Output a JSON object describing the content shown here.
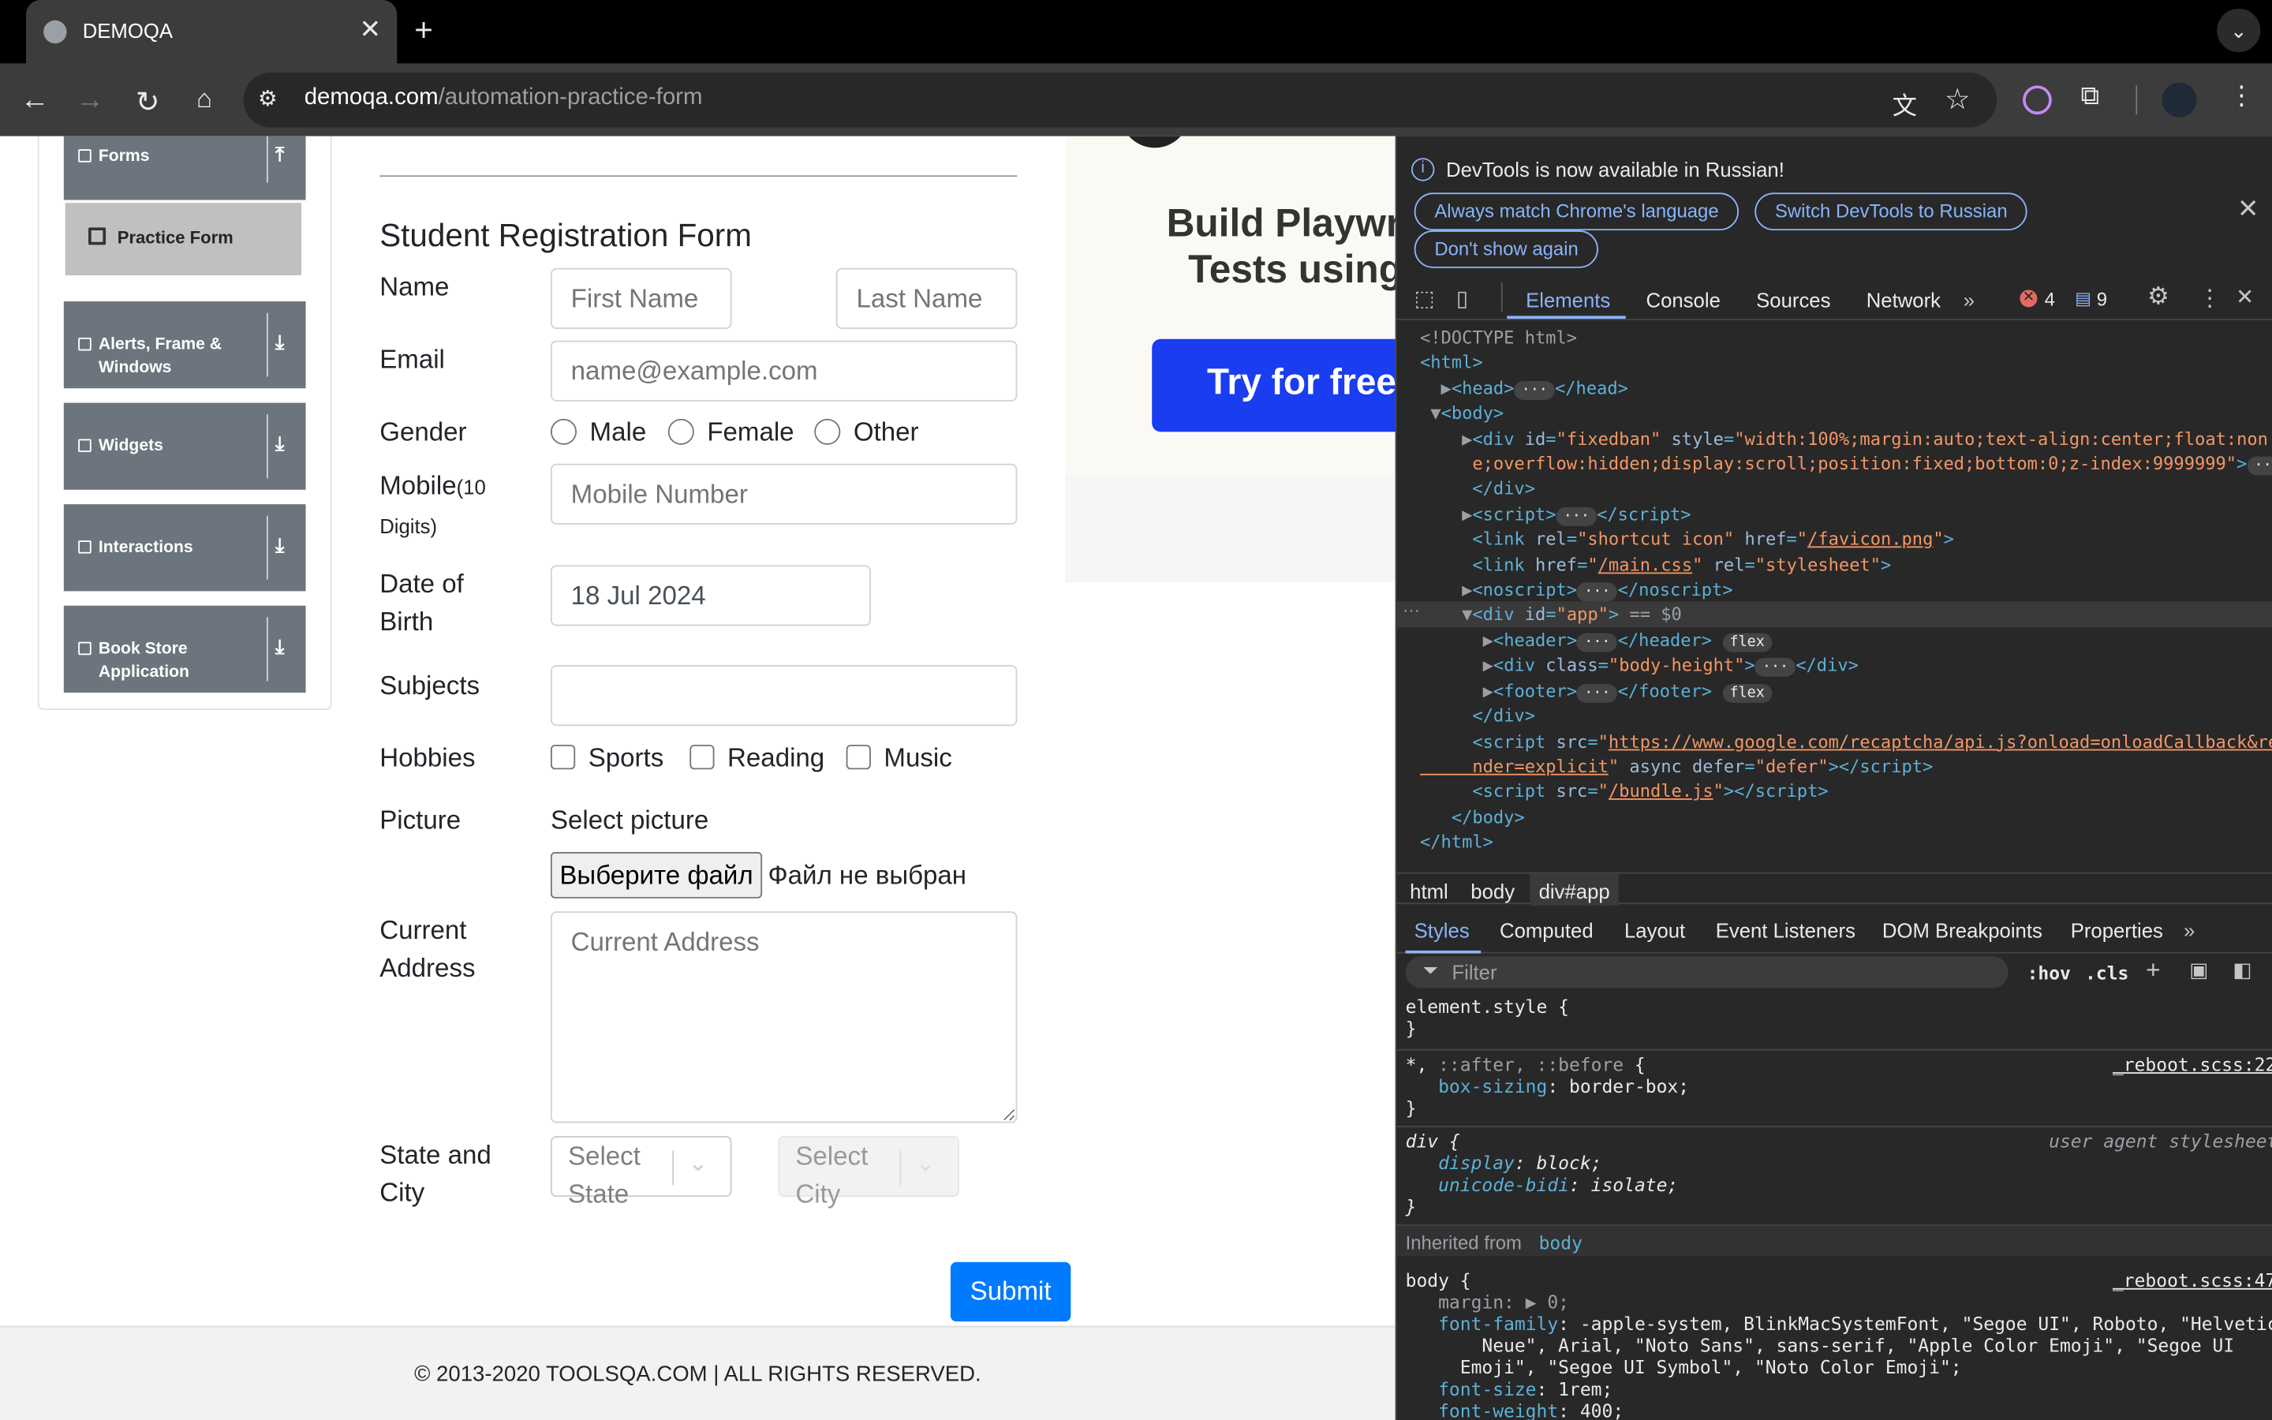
{
  "browser": {
    "tab_title": "DEMOQA",
    "url_host": "demoqa.com",
    "url_path": "/automation-practice-form"
  },
  "sidebar": {
    "items": [
      {
        "label": "Forms"
      },
      {
        "label": "Practice Form"
      },
      {
        "label": "Alerts, Frame & Windows"
      },
      {
        "label": "Widgets"
      },
      {
        "label": "Interactions"
      },
      {
        "label": "Book Store Application"
      }
    ]
  },
  "form": {
    "title": "Student Registration Form",
    "name_label": "Name",
    "first_name_placeholder": "First Name",
    "last_name_placeholder": "Last Name",
    "email_label": "Email",
    "email_placeholder": "name@example.com",
    "gender_label": "Gender",
    "gender_options": [
      "Male",
      "Female",
      "Other"
    ],
    "mobile_label": "Mobile",
    "mobile_hint": "(10 Digits)",
    "mobile_placeholder": "Mobile Number",
    "dob_label": "Date of Birth",
    "dob_value": "18 Jul 2024",
    "subjects_label": "Subjects",
    "hobbies_label": "Hobbies",
    "hobbies_options": [
      "Sports",
      "Reading",
      "Music"
    ],
    "picture_label": "Picture",
    "select_picture": "Select picture",
    "file_button": "Выберите файл",
    "file_status": "Файл не выбран",
    "address_label": "Current Address",
    "address_placeholder": "Current Address",
    "state_city_label": "State and City",
    "state_placeholder": "Select State",
    "city_placeholder": "Select City",
    "submit": "Submit"
  },
  "ad": {
    "headline_1": "Build Playwr",
    "headline_2": "Tests using",
    "button": "Try for free"
  },
  "footer": {
    "text": "© 2013-2020 TOOLSQA.COM | ALL RIGHTS RESERVED."
  },
  "devtools": {
    "info_message": "DevTools is now available in Russian!",
    "info_buttons": [
      "Always match Chrome's language",
      "Switch DevTools to Russian",
      "Don't show again"
    ],
    "tabs": [
      "Elements",
      "Console",
      "Sources",
      "Network"
    ],
    "error_count": "4",
    "message_count": "9",
    "breadcrumbs": [
      "html",
      "body",
      "div#app"
    ],
    "style_tabs": [
      "Styles",
      "Computed",
      "Layout",
      "Event Listeners",
      "DOM Breakpoints",
      "Properties"
    ],
    "filter_placeholder": "Filter",
    "hov": ":hov",
    "cls": ".cls",
    "inherited_prefix": "Inherited from",
    "inherited_from": "body"
  }
}
